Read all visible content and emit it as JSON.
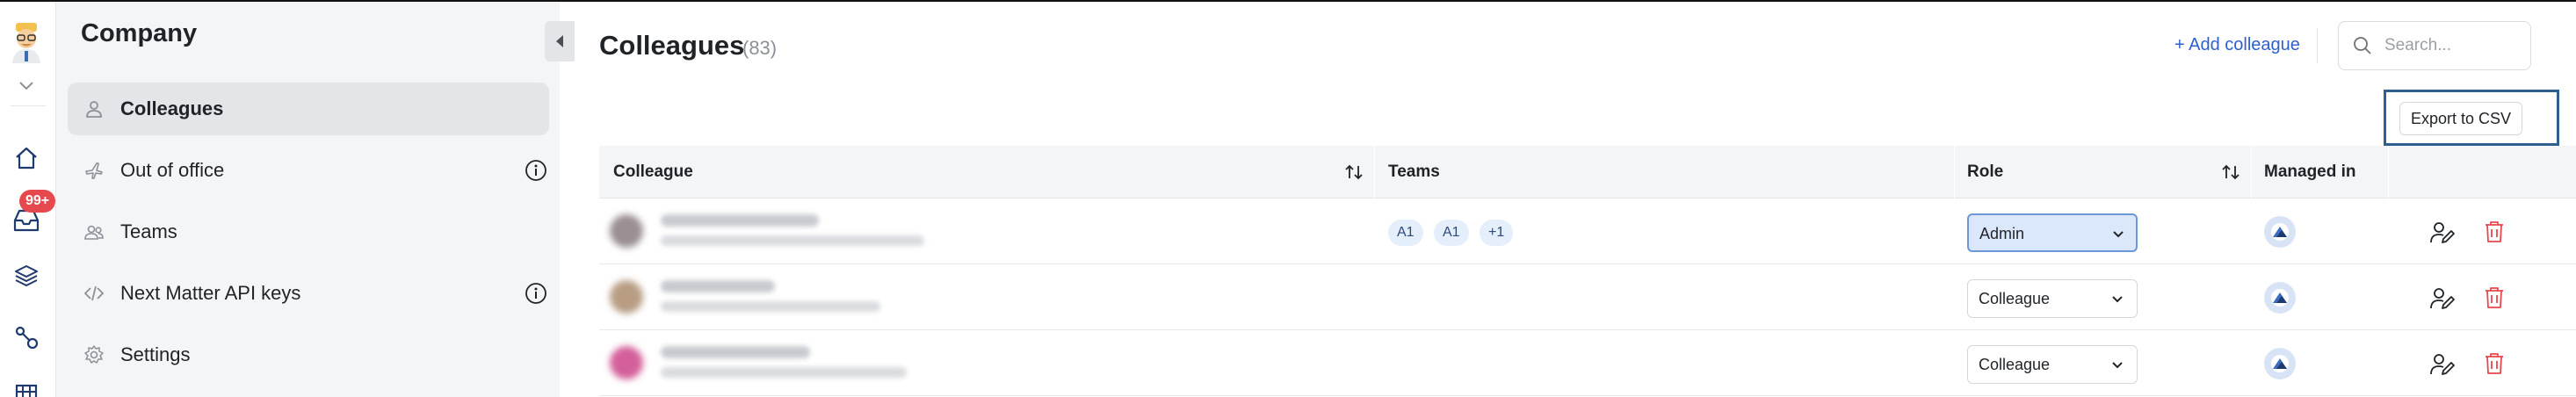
{
  "rail": {
    "badge": "99+",
    "icons": [
      "user-avatar",
      "chevron-down-icon",
      "home-icon",
      "inbox-icon",
      "layers-icon",
      "workflow-icon",
      "grid-icon"
    ]
  },
  "sidebar": {
    "title": "Company",
    "items": [
      {
        "label": "Colleagues",
        "icon": "user-icon",
        "active": true,
        "info": false
      },
      {
        "label": "Out of office",
        "icon": "plane-icon",
        "active": false,
        "info": true
      },
      {
        "label": "Teams",
        "icon": "users-icon",
        "active": false,
        "info": false
      },
      {
        "label": "Next Matter API keys",
        "icon": "code-icon",
        "active": false,
        "info": true
      },
      {
        "label": "Settings",
        "icon": "gear-icon",
        "active": false,
        "info": false
      }
    ]
  },
  "header": {
    "title": "Colleagues",
    "count": "(83)",
    "add_label": "+ Add colleague",
    "search_placeholder": "Search..."
  },
  "toolbar": {
    "export_label": "Export to CSV"
  },
  "table": {
    "columns": [
      "Colleague",
      "Teams",
      "Role",
      "Managed in"
    ],
    "rows": [
      {
        "teams": [
          "A1",
          "A1",
          "+1"
        ],
        "role": "Admin"
      },
      {
        "teams": [],
        "role": "Colleague"
      },
      {
        "teams": [],
        "role": "Colleague"
      }
    ]
  },
  "colors": {
    "accent": "#2f5fcf",
    "badge": "#e5484d",
    "delete": "#e5484d",
    "admin_select": "#dbe8fb",
    "sidebar_bg": "#f4f5f6"
  }
}
